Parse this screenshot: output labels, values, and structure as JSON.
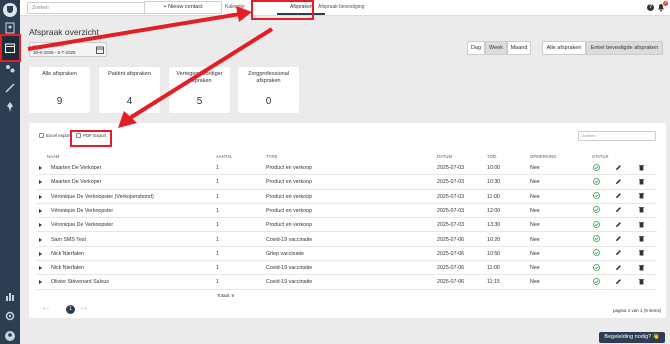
{
  "topbar": {
    "search_placeholder": "Zoeken",
    "new_contact": "+ Nieuw contact",
    "tabs": [
      "Kalender",
      "Afspraken",
      "Afspraak bevestiging"
    ],
    "help": "?",
    "notifications": "3"
  },
  "page": {
    "title": "Afspraak overzicht",
    "date_label": "Selecteer datum bereik",
    "date_value": "30-6-2025 - 6-7-2025"
  },
  "view_toggle": [
    "Dag",
    "Week",
    "Maand"
  ],
  "filter_toggle": [
    "Alle afspraken",
    "Enkel bevestigde afspraken"
  ],
  "stats": [
    {
      "label": "Alle afspraken",
      "value": "9"
    },
    {
      "label": "Patiënt afspraken",
      "value": "4"
    },
    {
      "label": "Vertegenwoordiger afspraken",
      "value": "5"
    },
    {
      "label": "Zorgprofessional afspraken",
      "value": "0"
    }
  ],
  "export": {
    "excel": "Excel export",
    "pdf": "PDF Export",
    "search_placeholder": "Zoeken"
  },
  "table": {
    "columns": [
      "NAAM",
      "AANTAL",
      "TYPE",
      "DATUM",
      "TOD.",
      "OPMERKING",
      "STATUS"
    ],
    "rows": [
      {
        "naam": "Maarten De Verkoper",
        "aantal": "1",
        "type": "Product en verkoop",
        "datum": "2025-07-03",
        "tijd": "10:00",
        "opmerking": "Nee"
      },
      {
        "naam": "Maarten De Verkoper",
        "aantal": "1",
        "type": "Product en verkoop",
        "datum": "2025-07-03",
        "tijd": "10:30",
        "opmerking": "Nee"
      },
      {
        "naam": "Véronique De Verkoopster (Verkopersbond)",
        "aantal": "1",
        "type": "Product en verkoop",
        "datum": "2025-07-03",
        "tijd": "11:00",
        "opmerking": "Nee"
      },
      {
        "naam": "Véronique De Verkoopster",
        "aantal": "1",
        "type": "Product en verkoop",
        "datum": "2025-07-03",
        "tijd": "12:00",
        "opmerking": "Nee"
      },
      {
        "naam": "Véronique De Verkoopster",
        "aantal": "1",
        "type": "Product en verkoop",
        "datum": "2025-07-03",
        "tijd": "13:30",
        "opmerking": "Nee"
      },
      {
        "naam": "Sam SMS Test",
        "aantal": "1",
        "type": "Covid-19 vaccinatie",
        "datum": "2025-07-06",
        "tijd": "10:20",
        "opmerking": "Nee"
      },
      {
        "naam": "Nick Nierfalen",
        "aantal": "1",
        "type": "Griep vaccinatie",
        "datum": "2025-07-06",
        "tijd": "10:50",
        "opmerking": "Nee"
      },
      {
        "naam": "Nick Nierfalen",
        "aantal": "1",
        "type": "Covid-19 vaccinatie",
        "datum": "2025-07-06",
        "tijd": "11:00",
        "opmerking": "Nee"
      },
      {
        "naam": "Olivier Stévenard Salvus",
        "aantal": "1",
        "type": "Covid-19 vaccinatie",
        "datum": "2025-07-06",
        "tijd": "11:15",
        "opmerking": "Nee"
      }
    ],
    "total": "Totaal: 9"
  },
  "pagination": {
    "prev": "«  ‹",
    "current": "1",
    "next": "›  »",
    "info": "pagina 1 van 1 (9 items)"
  },
  "help_button": "Begeleiding nodig? 👋",
  "colors": {
    "sidebar": "#2e3e52",
    "accent_red": "#e41e26",
    "status_green": "#2e9e4a"
  }
}
